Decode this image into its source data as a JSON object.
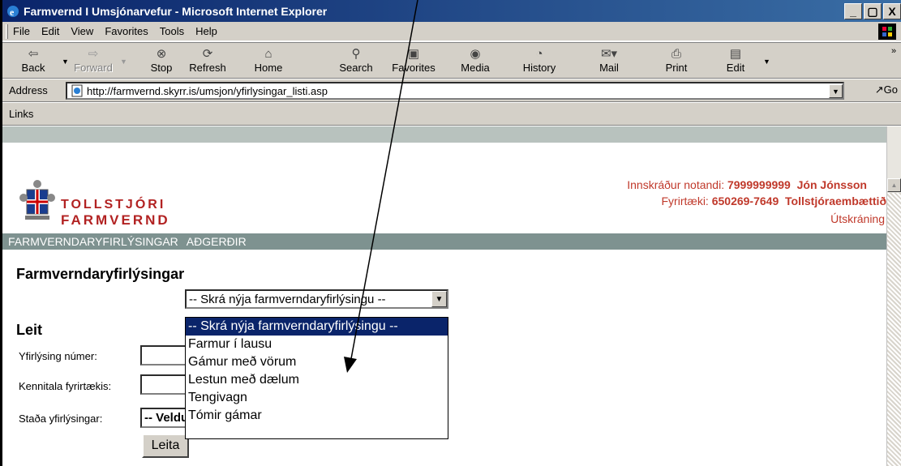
{
  "window": {
    "title": "Farmvernd I Umsjónarvefur - Microsoft Internet Explorer",
    "min_label": "_",
    "max_label": "▢",
    "close_label": "X"
  },
  "menu": [
    "File",
    "Edit",
    "View",
    "Favorites",
    "Tools",
    "Help"
  ],
  "toolbar": {
    "buttons": [
      {
        "label": "Back",
        "icon": "back-arrow-icon"
      },
      {
        "label": "Forward",
        "icon": "forward-arrow-icon"
      },
      {
        "label": "Stop",
        "icon": "stop-icon"
      },
      {
        "label": "Refresh",
        "icon": "refresh-icon"
      },
      {
        "label": "Home",
        "icon": "home-icon"
      },
      {
        "label": "Search",
        "icon": "search-icon"
      },
      {
        "label": "Favorites",
        "icon": "favorites-icon"
      },
      {
        "label": "Media",
        "icon": "media-icon"
      },
      {
        "label": "History",
        "icon": "history-icon"
      },
      {
        "label": "Mail",
        "icon": "mail-icon"
      },
      {
        "label": "Print",
        "icon": "print-icon"
      },
      {
        "label": "Edit",
        "icon": "edit-icon"
      }
    ],
    "overflow": "»"
  },
  "address": {
    "label": "Address",
    "url": "http://farmvernd.skyrr.is/umsjon/yfirlysingar_listi.asp",
    "go_label": "Go"
  },
  "links": {
    "label": "Links"
  },
  "site": {
    "brand_line1": "TOLLSTJÓRI",
    "brand_line2": "FARMVERND",
    "user_label": "Innskráður notandi:",
    "user_id": "7999999999",
    "user_name": "Jón Jónsson",
    "company_label": "Fyrirtæki:",
    "company_id": "650269-7649",
    "company_name": "Tollstjóraembættið",
    "logout": "Útskráning",
    "nav": [
      "FARMVERNDARYFIRLÝSINGAR",
      "AÐGERÐIR"
    ]
  },
  "main": {
    "title": "Farmverndaryfirlýsingar",
    "new_select_value": "-- Skrá nýja farmverndaryfirlýsingu --",
    "dropdown_options": [
      "-- Skrá nýja farmverndaryfirlýsingu --",
      "Farmur í lausu",
      "Gámur með vörum",
      "Lestun með dælum",
      "Tengivagn",
      "Tómir gámar"
    ],
    "search_title": "Leit",
    "field_number_label": "Yfirlýsing númer:",
    "field_kennitala_label": "Kennitala fyrirtækis:",
    "field_status_label": "Staða yfirlýsingar:",
    "status_value": "-- Veldu",
    "search_button": "Leita"
  },
  "colors": {
    "titlebar": "#0a246a",
    "brand": "#b22222",
    "navbar": "#7e9290",
    "selection": "#0a246a"
  }
}
